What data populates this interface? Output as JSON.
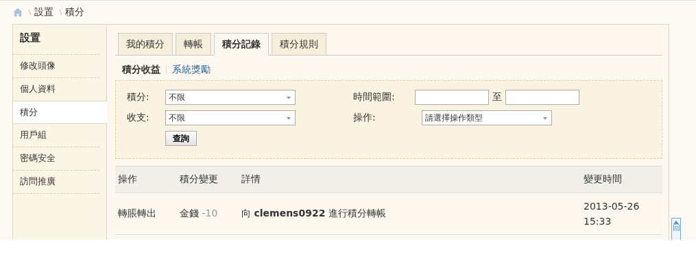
{
  "breadcrumb": [
    "設置",
    "積分"
  ],
  "sidebar": {
    "title": "設置",
    "items": [
      {
        "label": "修改頭像",
        "selected": false
      },
      {
        "label": "個人資料",
        "selected": false
      },
      {
        "label": "積分",
        "selected": true
      },
      {
        "label": "用戶組",
        "selected": false
      },
      {
        "label": "密碼安全",
        "selected": false
      },
      {
        "label": "訪問推廣",
        "selected": false
      }
    ]
  },
  "tabs": [
    {
      "label": "我的積分",
      "selected": false
    },
    {
      "label": "轉帳",
      "selected": false
    },
    {
      "label": "積分記錄",
      "selected": true
    },
    {
      "label": "積分規則",
      "selected": false
    }
  ],
  "subtabs": [
    {
      "label": "積分收益",
      "selected": true
    },
    {
      "label": "系統獎勵",
      "selected": false
    }
  ],
  "filters": {
    "credit": {
      "label": "積分:",
      "value": "不限"
    },
    "type": {
      "label": "收支:",
      "value": "不限"
    },
    "time": {
      "label": "時間範圍:",
      "separator": "至"
    },
    "operation": {
      "label": "操作:",
      "value": "請選擇操作類型"
    },
    "submit": "查詢"
  },
  "table": {
    "columns": [
      "操作",
      "積分變更",
      "詳情",
      "變更時間"
    ],
    "rows": [
      {
        "operation": "轉賬轉出",
        "credit": "金錢",
        "amount": "-10",
        "detail": "向 **clemens0922** 進行積分轉帳",
        "date": "2013-05-26",
        "time": "15:33"
      }
    ]
  },
  "back_to_top": "回"
}
